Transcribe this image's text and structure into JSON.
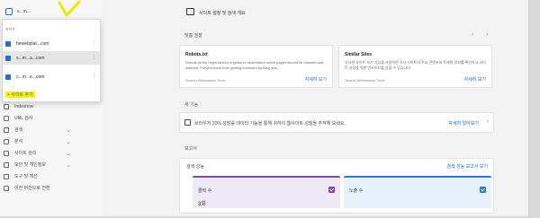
{
  "sidebar": {
    "site_select": "s...m...",
    "nav": [
      {
        "label": "Indexnow",
        "chevron": false
      },
      {
        "label": "URL 검사",
        "chevron": false
      },
      {
        "label": "검색",
        "chevron": true
      },
      {
        "label": "분석",
        "chevron": true
      },
      {
        "label": "사이트 관리",
        "chevron": true
      },
      {
        "label": "보안 및 개인정보",
        "chevron": true
      },
      {
        "label": "도구 및 개선",
        "chevron": false
      },
      {
        "label": "이전 버전으로 전환",
        "chevron": false
      }
    ]
  },
  "dropdown": {
    "caption": "사이트",
    "items": [
      {
        "label": "hewebplat...com"
      },
      {
        "label": "s...m...a...com"
      },
      {
        "label": "c...m...e...com"
      }
    ],
    "add_label": "+ 사이트 추가"
  },
  "header": {
    "title": "사이트 설정 및 검색 개요"
  },
  "recommendations": {
    "label": "맞춤 권장",
    "cards": [
      {
        "title": "Robots.txt",
        "body": "Robots.txt file helps search engines to understand which pages should be crawled and indexed. Prevent them from getting confused by Bing and...",
        "foot": "Search Webmaster Tools",
        "link": "자세히 보기"
      },
      {
        "title": "Similar Sites",
        "body": "유사한 사이트 보기 기능을 사용하면 유사 사이트의 주요 콘텐츠와 트래픽 정보를 확인하고 사이트 성장을 위한 인사이트를 얻을 수 있습니다.",
        "foot": "Search Webmaster Tools",
        "link": "자세히 보기"
      }
    ]
  },
  "news": {
    "label": "새 기능",
    "text": "브라우저 20% 성장률 데이터 기능을 통해 귀하의 웹사이트 성장을 추적해 보세요.",
    "link": "자세히 알아보기"
  },
  "reports": {
    "label": "보고서",
    "panel_label": "검색 성능",
    "link": "검색 성능 보고서 보기",
    "tiles": [
      {
        "label": "클릭 수",
        "value": "3회",
        "color": "#efe8f6",
        "check": "#7b4fa6"
      },
      {
        "label": "노출 수",
        "value": "",
        "color": "#e6f1fb",
        "check": "#2a7bd1"
      }
    ]
  },
  "colors": {
    "accent": "#1a63c8",
    "highlight": "#fff200",
    "annotation": "#f2e500"
  }
}
